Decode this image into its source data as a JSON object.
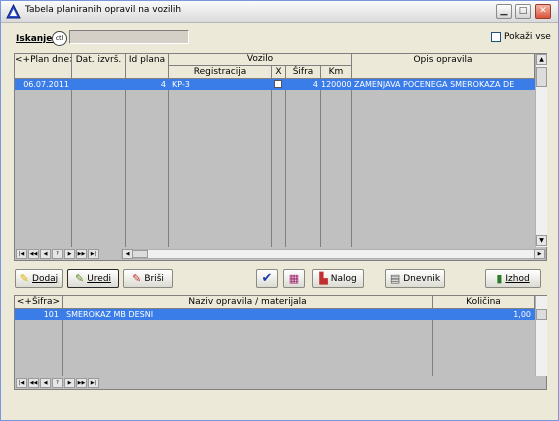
{
  "window": {
    "title": "Tabela planiranih opravil na vozilih"
  },
  "search": {
    "label": "Iskanje:",
    "icon_text": "ctl",
    "value": ""
  },
  "show_all": {
    "label": "Pokaži vse",
    "checked": false
  },
  "plans_table": {
    "headers": {
      "plan_date": "<+Plan dne>",
      "exec_date": "Dat. izvrš.",
      "plan_id": "Id plana",
      "vehicle_group": "Vozilo",
      "registration": "Registracija",
      "x": "X",
      "code": "Šifra",
      "km": "Km",
      "description": "Opis opravila"
    },
    "rows": [
      {
        "plan_date": "06.07.2011",
        "exec_date": "",
        "plan_id": "4",
        "registration": "KP-3",
        "x_checked": false,
        "code": "4",
        "km": "120000",
        "description": "ZAMENJAVA POCENEGA SMEROKAZA DE"
      }
    ]
  },
  "toolbar": {
    "add": "Dodaj",
    "edit": "Uredi",
    "delete": "Briši",
    "order": "Nalog",
    "log": "Dnevnik",
    "exit": "Izhod"
  },
  "items_table": {
    "headers": {
      "code": "<+Šifra>",
      "name": "Naziv opravila / materijala",
      "qty": "Količina"
    },
    "rows": [
      {
        "code": "101",
        "name": "SMEROKAZ MB DESNI",
        "qty": "1,00"
      }
    ]
  },
  "navigator": [
    "first",
    "prev-page",
    "prev",
    "help",
    "next",
    "next-page",
    "last"
  ],
  "colors": {
    "selection": "#3a7ce8",
    "grid_bg": "#c0c0c0",
    "window_bg": "#ece9d8"
  }
}
